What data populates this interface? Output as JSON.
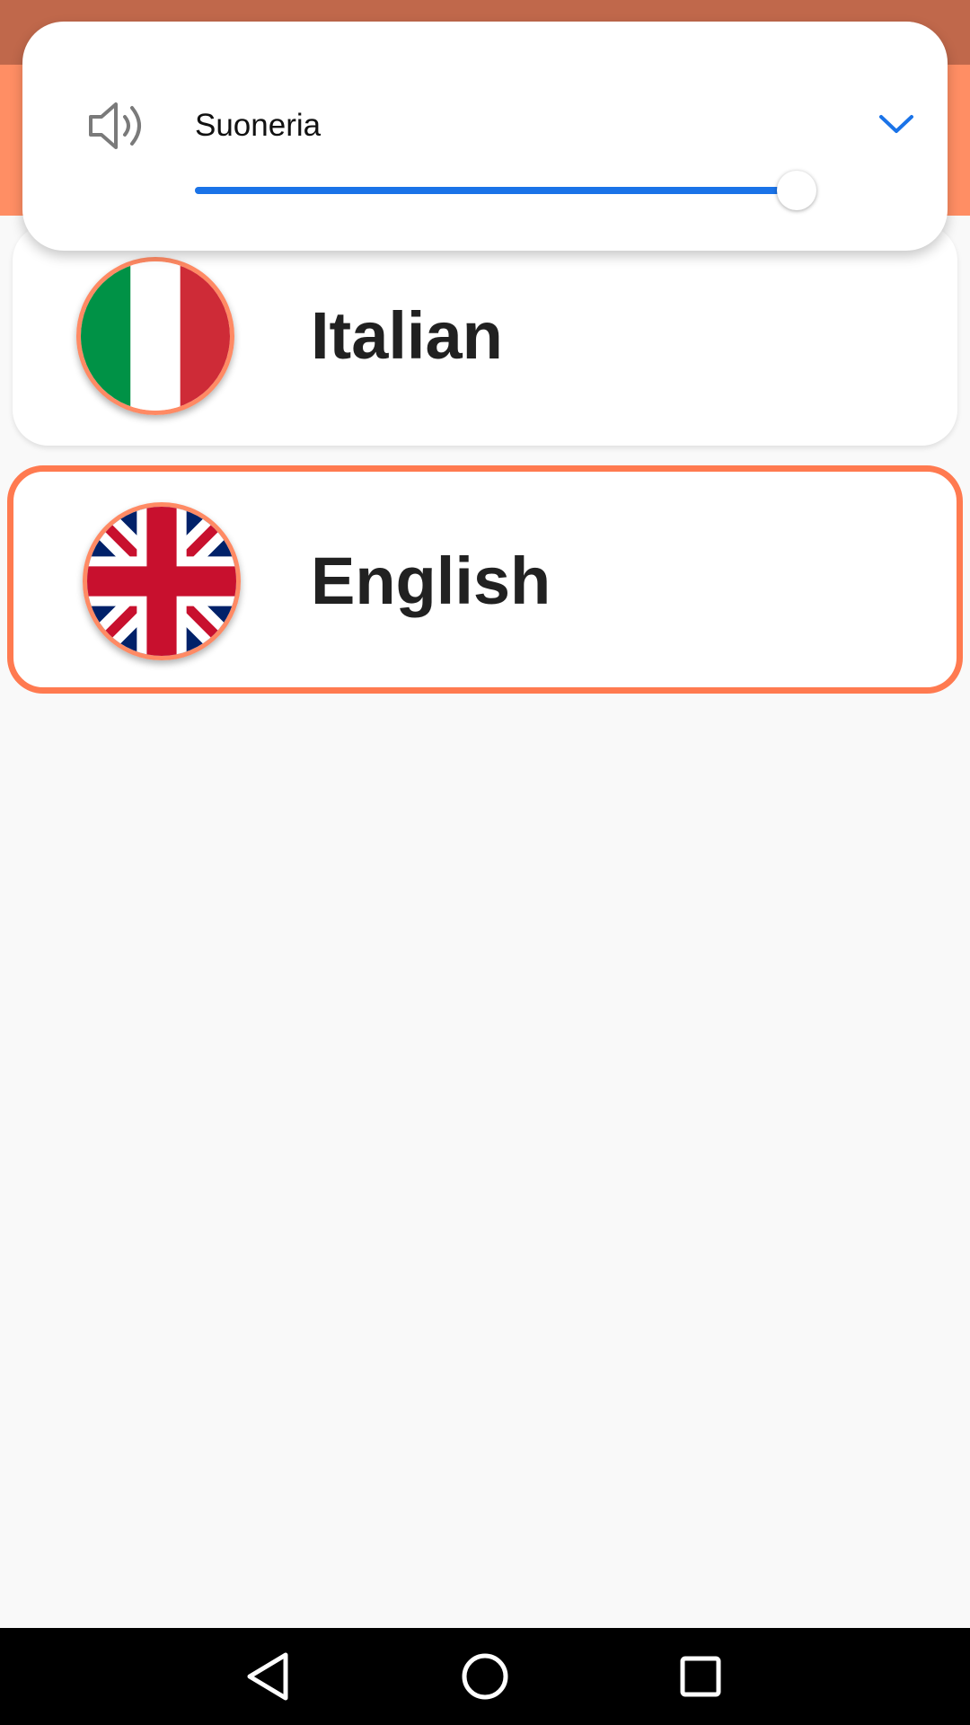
{
  "volume_panel": {
    "label": "Suoneria",
    "level": 0.98,
    "icon": "speaker-icon",
    "expand_icon": "chevron-down-icon",
    "accent_color": "#1a73e8"
  },
  "languages": [
    {
      "name": "Italian",
      "flag": "italy-flag-icon",
      "selected": false
    },
    {
      "name": "English",
      "flag": "uk-flag-icon",
      "selected": true
    }
  ],
  "colors": {
    "primary": "#ff8e64",
    "status_bar": "#c0684b",
    "selected_border": "#ff7a50"
  },
  "nav": {
    "back_icon": "back-triangle-icon",
    "home_icon": "home-circle-icon",
    "recent_icon": "recent-square-icon"
  }
}
